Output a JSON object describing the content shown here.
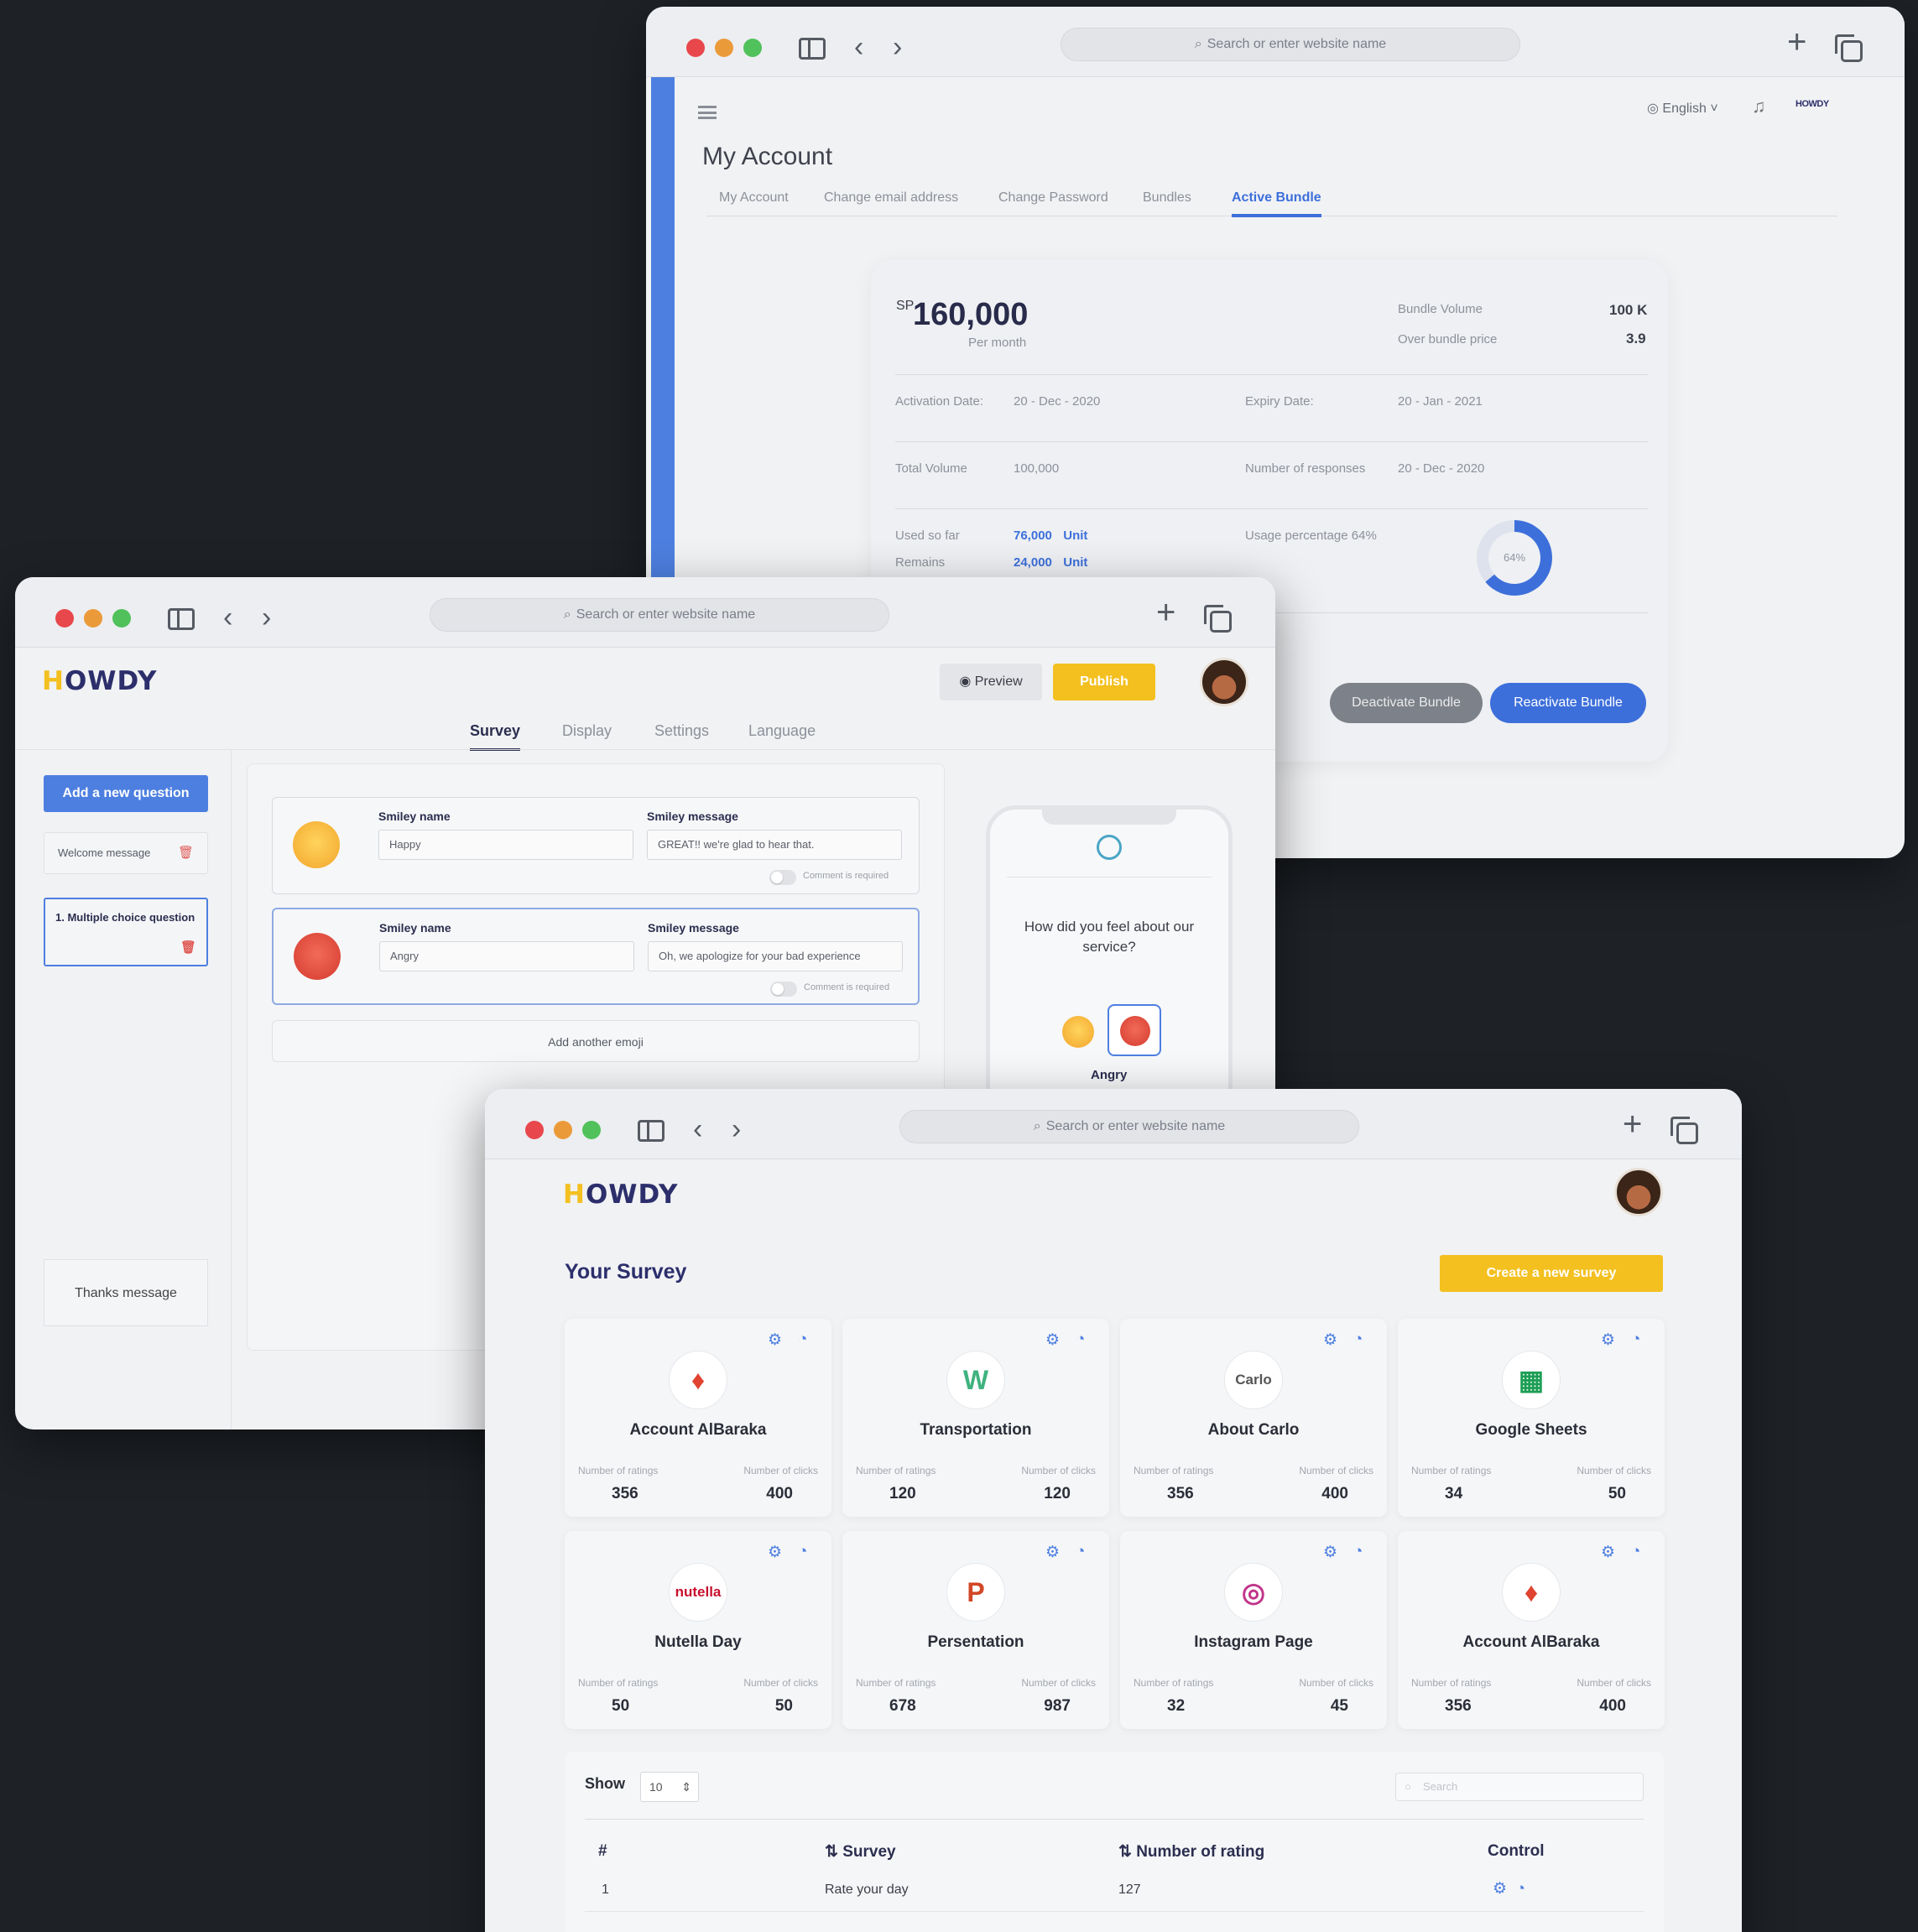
{
  "browser": {
    "url_placeholder": "Search or enter website name"
  },
  "account_window": {
    "language": "English ˅",
    "title": "My Account",
    "tabs": [
      "My Account",
      "Change email address",
      "Change Password",
      "Bundles",
      "Active Bundle"
    ],
    "active_tab": "Active Bundle",
    "price_currency": "SP",
    "price": "160,000",
    "price_period": "Per month",
    "bundle_volume_label": "Bundle Volume",
    "bundle_volume": "100 K",
    "over_bundle_label": "Over bundle price",
    "over_bundle": "3.9",
    "activation_label": "Activation Date:",
    "activation": "20 - Dec - 2020",
    "expiry_label": "Expiry Date:",
    "expiry": "20 - Jan - 2021",
    "total_volume_label": "Total Volume",
    "total_volume": "100,000",
    "responses_label": "Number of responses",
    "responses": "20 - Dec - 2020",
    "used_label": "Used so far",
    "used": "76,000",
    "remains_label": "Remains",
    "remains": "24,000",
    "unit": "Unit",
    "usage_label": "Usage percentage",
    "usage_value": "64%",
    "usage_fraction": 0.64,
    "deactivate": "Deactivate Bundle",
    "reactivate": "Reactivate Bundle"
  },
  "editor_window": {
    "logo": "HOWDY",
    "preview": "Preview",
    "publish": "Publish",
    "tabs": [
      "Survey",
      "Display",
      "Settings",
      "Language"
    ],
    "active_tab": "Survey",
    "add_question": "Add a new question",
    "welcome": "Welcome message",
    "question": "1. Multiple choice question",
    "thanks": "Thanks message",
    "smiley_name_label": "Smiley name",
    "smiley_message_label": "Smiley message",
    "comment_required": "Comment is required",
    "smileys": [
      {
        "name": "Happy",
        "message": "GREAT!! we're glad to hear that."
      },
      {
        "name": "Angry",
        "message": "Oh, we apologize for your bad experience"
      }
    ],
    "add_emoji": "Add another emoji",
    "phone_question": "How did you feel about our service?",
    "phone_selected": "Angry"
  },
  "surveys_window": {
    "logo": "HOWDY",
    "title": "Your Survey",
    "create": "Create a new survey",
    "ratings_label": "Number of ratings",
    "clicks_label": "Number of clicks",
    "cards": [
      {
        "name": "Account AlBaraka",
        "ratings": "356",
        "clicks": "400",
        "icon": "albaraka-logo",
        "glyph": "♦",
        "color": "#e0432f"
      },
      {
        "name": "Transportation",
        "ratings": "120",
        "clicks": "120",
        "icon": "transport-logo",
        "glyph": "W",
        "color": "#3fb27f"
      },
      {
        "name": "About Carlo",
        "ratings": "356",
        "clicks": "400",
        "icon": "carlo-logo",
        "glyph": "Carlo",
        "color": "#555"
      },
      {
        "name": "Google Sheets",
        "ratings": "34",
        "clicks": "50",
        "icon": "sheets-logo",
        "glyph": "▦",
        "color": "#1e9e55"
      },
      {
        "name": "Nutella Day",
        "ratings": "50",
        "clicks": "50",
        "icon": "nutella-logo",
        "glyph": "nutella",
        "color": "#c8102e"
      },
      {
        "name": "Persentation",
        "ratings": "678",
        "clicks": "987",
        "icon": "powerpoint-logo",
        "glyph": "P",
        "color": "#d24726"
      },
      {
        "name": "Instagram Page",
        "ratings": "32",
        "clicks": "45",
        "icon": "instagram-logo",
        "glyph": "◎",
        "color": "#c1358a"
      },
      {
        "name": "Account AlBaraka",
        "ratings": "356",
        "clicks": "400",
        "icon": "albaraka-logo",
        "glyph": "♦",
        "color": "#e0432f"
      }
    ],
    "show_label": "Show",
    "show_value": "10",
    "search_placeholder": "Search",
    "table_headers": [
      "#",
      "⇅ Survey",
      "⇅ Number of rating",
      "Control"
    ],
    "rows": [
      {
        "num": "1",
        "survey": "Rate your day",
        "rating": "127"
      }
    ]
  }
}
